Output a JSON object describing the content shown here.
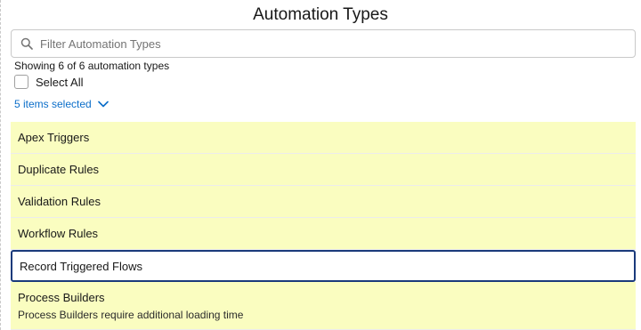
{
  "header": {
    "title": "Automation Types"
  },
  "search": {
    "placeholder": "Filter Automation Types",
    "value": ""
  },
  "summary": {
    "showing_text": "Showing 6 of 6 automation types"
  },
  "select_all": {
    "label": "Select All",
    "checked": false
  },
  "selection": {
    "label": "5 items selected"
  },
  "items": [
    {
      "label": "Apex Triggers",
      "selected": true
    },
    {
      "label": "Duplicate Rules",
      "selected": true
    },
    {
      "label": "Validation Rules",
      "selected": true
    },
    {
      "label": "Workflow Rules",
      "selected": true
    },
    {
      "label": "Record Triggered Flows",
      "selected": false,
      "focused": true
    },
    {
      "label": "Process Builders",
      "selected": true,
      "note": "Process Builders require additional loading time"
    }
  ],
  "colors": {
    "selected_row_bg": "#fafdc0",
    "focus_border": "#1a3a7b",
    "link": "#0b6ec9"
  },
  "icons": {
    "search": "search-icon",
    "chevron": "chevron-down-icon"
  }
}
